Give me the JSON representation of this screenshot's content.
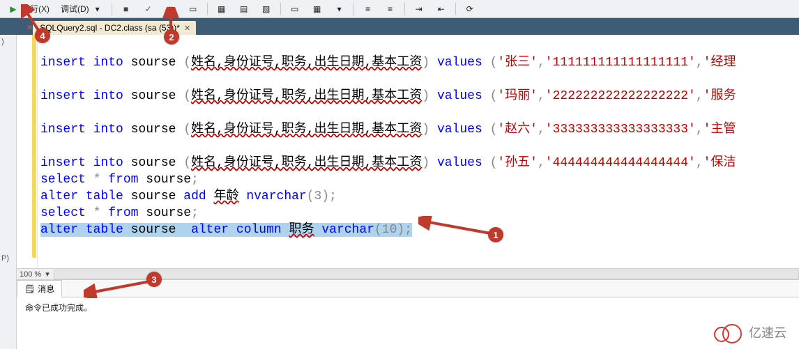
{
  "toolbar": {
    "execute_label": "执行(X)",
    "debug_label": "调试(D)"
  },
  "tab": {
    "title": "SQLQuery2.sql - DC2.class (sa (53))*"
  },
  "left_panel": {
    "top_label": ")",
    "bottom_label": "P)"
  },
  "code": {
    "line1_a": "insert",
    "line1_b": "into",
    "line1_obj": "sourse",
    "line1_cols": "姓名,身份证号,职务,出生日期,基本工资",
    "line1_kw2": "values",
    "line1_v1": "'张三'",
    "line1_v2": "'111111111111111111'",
    "line1_v3": "'经理",
    "line2_a": "insert",
    "line2_b": "into",
    "line2_obj": "sourse",
    "line2_cols": "姓名,身份证号,职务,出生日期,基本工资",
    "line2_kw2": "values",
    "line2_v1": "'玛丽'",
    "line2_v2": "'222222222222222222'",
    "line2_v3": "'服务",
    "line3_a": "insert",
    "line3_b": "into",
    "line3_obj": "sourse",
    "line3_cols": "姓名,身份证号,职务,出生日期,基本工资",
    "line3_kw2": "values",
    "line3_v1": "'赵六'",
    "line3_v2": "'333333333333333333'",
    "line3_v3": "'主管",
    "line4_a": "insert",
    "line4_b": "into",
    "line4_obj": "sourse",
    "line4_cols": "姓名,身份证号,职务,出生日期,基本工资",
    "line4_kw2": "values",
    "line4_v1": "'孙五'",
    "line4_v2": "'444444444444444444'",
    "line4_v3": "'保洁",
    "line5": "select * from sourse;",
    "line5_a": "select",
    "line5_star": "*",
    "line5_b": "from",
    "line5_obj": "sourse",
    "line6_a": "alter",
    "line6_b": "table",
    "line6_obj": "sourse",
    "line6_c": "add",
    "line6_col": "年龄",
    "line6_type": "nvarchar",
    "line6_p": "(3)",
    "line7_a": "select",
    "line7_star": "*",
    "line7_b": "from",
    "line7_obj": "sourse",
    "line8_a": "alter",
    "line8_b": "table",
    "line8_obj": "sourse",
    "line8_c": "alter",
    "line8_d": "column",
    "line8_col": "职务",
    "line8_type": "varchar",
    "line8_p": "(10)"
  },
  "zoom": {
    "value": "100 %"
  },
  "messages": {
    "tab_label": "消息",
    "text": "命令已成功完成。"
  },
  "annotations": {
    "b1": "1",
    "b2": "2",
    "b3": "3",
    "b4": "4"
  },
  "watermark": {
    "text": "亿速云"
  }
}
